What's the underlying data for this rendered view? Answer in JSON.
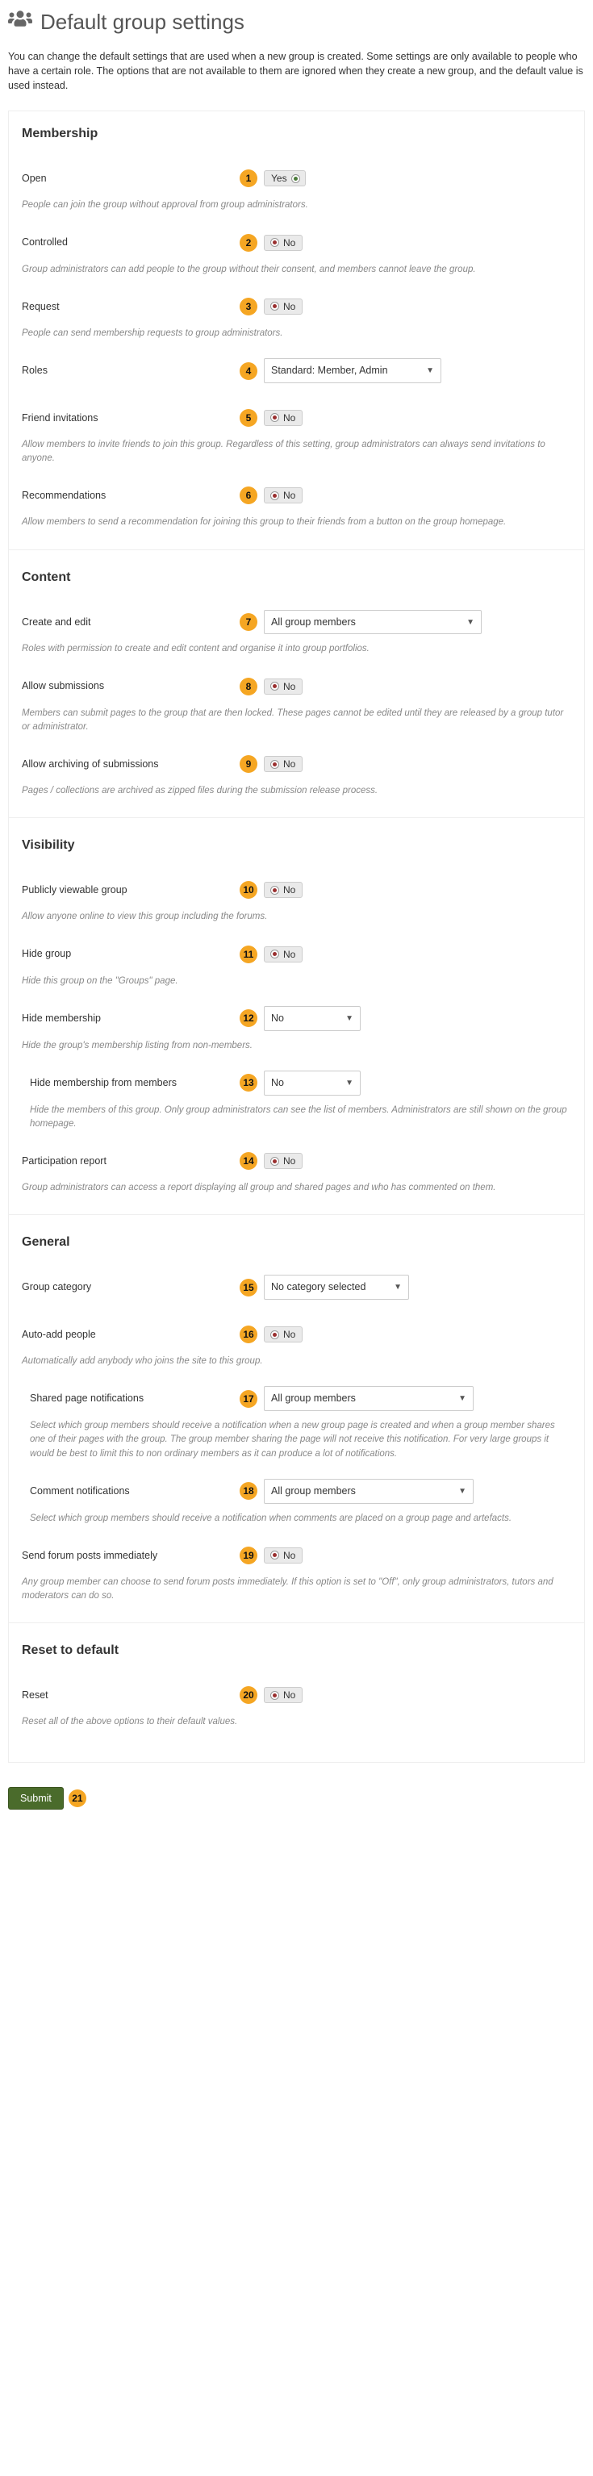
{
  "page": {
    "title": "Default group settings",
    "intro": "You can change the default settings that are used when a new group is created. Some settings are only available to people who have a certain role. The options that are not available to them are ignored when they create a new group, and the default value is used instead."
  },
  "sections": {
    "membership": "Membership",
    "content": "Content",
    "visibility": "Visibility",
    "general": "General",
    "reset": "Reset to default"
  },
  "markers": {
    "m1": "1",
    "m2": "2",
    "m3": "3",
    "m4": "4",
    "m5": "5",
    "m6": "6",
    "m7": "7",
    "m8": "8",
    "m9": "9",
    "m10": "10",
    "m11": "11",
    "m12": "12",
    "m13": "13",
    "m14": "14",
    "m15": "15",
    "m16": "16",
    "m17": "17",
    "m18": "18",
    "m19": "19",
    "m20": "20",
    "m21": "21"
  },
  "fields": {
    "open": {
      "label": "Open",
      "value": "Yes",
      "help": "People can join the group without approval from group administrators."
    },
    "controlled": {
      "label": "Controlled",
      "value": "No",
      "help": "Group administrators can add people to the group without their consent, and members cannot leave the group."
    },
    "request": {
      "label": "Request",
      "value": "No",
      "help": "People can send membership requests to group administrators."
    },
    "roles": {
      "label": "Roles",
      "value": "Standard: Member, Admin"
    },
    "friendinv": {
      "label": "Friend invitations",
      "value": "No",
      "help": "Allow members to invite friends to join this group. Regardless of this setting, group administrators can always send invitations to anyone."
    },
    "recommend": {
      "label": "Recommendations",
      "value": "No",
      "help": "Allow members to send a recommendation for joining this group to their friends from a button on the group homepage."
    },
    "createedit": {
      "label": "Create and edit",
      "value": "All group members",
      "help": "Roles with permission to create and edit content and organise it into group portfolios."
    },
    "allowsub": {
      "label": "Allow submissions",
      "value": "No",
      "help": "Members can submit pages to the group that are then locked. These pages cannot be edited until they are released by a group tutor or administrator."
    },
    "allowarch": {
      "label": "Allow archiving of submissions",
      "value": "No",
      "help": "Pages / collections are archived as zipped files during the submission release process."
    },
    "public": {
      "label": "Publicly viewable group",
      "value": "No",
      "help": "Allow anyone online to view this group including the forums."
    },
    "hidegroup": {
      "label": "Hide group",
      "value": "No",
      "help": "Hide this group on the \"Groups\" page."
    },
    "hidemember": {
      "label": "Hide membership",
      "value": "No",
      "help": "Hide the group's membership listing from non-members."
    },
    "hidememfrom": {
      "label": "Hide membership from members",
      "value": "No",
      "help": "Hide the members of this group. Only group administrators can see the list of members. Administrators are still shown on the group homepage."
    },
    "participation": {
      "label": "Participation report",
      "value": "No",
      "help": "Group administrators can access a report displaying all group and shared pages and who has commented on them."
    },
    "category": {
      "label": "Group category",
      "value": "No category selected"
    },
    "autoadd": {
      "label": "Auto-add people",
      "value": "No",
      "help": "Automatically add anybody who joins the site to this group."
    },
    "sharednotify": {
      "label": "Shared page notifications",
      "value": "All group members",
      "help": "Select which group members should receive a notification when a new group page is created and when a group member shares one of their pages with the group. The group member sharing the page will not receive this notification. For very large groups it would be best to limit this to non ordinary members as it can produce a lot of notifications."
    },
    "commentnotify": {
      "label": "Comment notifications",
      "value": "All group members",
      "help": "Select which group members should receive a notification when comments are placed on a group page and artefacts."
    },
    "sendforum": {
      "label": "Send forum posts immediately",
      "value": "No",
      "help": "Any group member can choose to send forum posts immediately. If this option is set to \"Off\", only group administrators, tutors and moderators can do so."
    },
    "reset": {
      "label": "Reset",
      "value": "No",
      "help": "Reset all of the above options to their default values."
    }
  },
  "submit": {
    "label": "Submit"
  }
}
